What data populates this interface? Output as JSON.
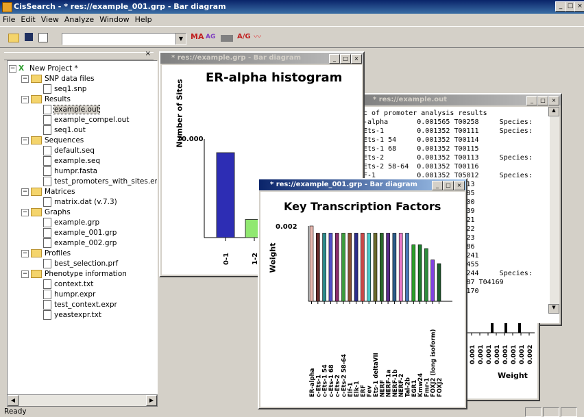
{
  "window": {
    "title": "CisSearch - * res://example_001.grp - Bar diagram"
  },
  "menu": [
    "File",
    "Edit",
    "View",
    "Analyze",
    "Window",
    "Help"
  ],
  "toolbar": {
    "search_value": "",
    "tool1": "MA",
    "tool2": "AG",
    "tool3": "A/G"
  },
  "tree": {
    "root": "New Project *",
    "groups": [
      {
        "label": "SNP data files",
        "items": [
          "seq1.snp"
        ]
      },
      {
        "label": "Results",
        "items": [
          "example.out",
          "example_compel.out",
          "seq1.out"
        ]
      },
      {
        "label": "Sequences",
        "items": [
          "default.seq",
          "example.seq",
          "humpr.fasta",
          "test_promoters_with_sites.emb"
        ]
      },
      {
        "label": "Matrices",
        "items": [
          "matrix.dat (v.7.3)"
        ]
      },
      {
        "label": "Graphs",
        "items": [
          "example.grp",
          "example_001.grp",
          "example_002.grp"
        ]
      },
      {
        "label": "Profiles",
        "items": [
          "best_selection.prf"
        ]
      },
      {
        "label": "Phenotype information",
        "items": [
          "context.txt",
          "humpr.expr",
          "test_context.expr",
          "yeastexpr.txt"
        ]
      }
    ]
  },
  "win_erhist": {
    "title": "* res://example.grp - Bar diagram",
    "chart_title": "ER-alpha histogram",
    "ylabel": "Number of Sites",
    "ytick": "70.000",
    "categories": [
      "0-1",
      "1-2"
    ]
  },
  "win_text": {
    "title": "* res://example.out",
    "lines": [
      "c of promoter analysis results",
      "-alpha       0.001565 T00258     Species:",
      "Ets-1        0.001352 T00111     Species:",
      "Ets-1 54     0.001352 T00114",
      "Ets-1 68     0.001352 T00115",
      "Ets-2        0.001352 T00113     Species:",
      "Ets-2 58-64  0.001352 T00116",
      "F-1          0.001352 T05012     Species:",
      "                      05013",
      "                      04885",
      "                      01400",
      "                      05039",
      "                      05021",
      "                      05022",
      "                      05023",
      "                      04886",
      "                      T00241",
      "                      T00455",
      "                      T00244     Species:",
      "                      06087 T04169",
      "                      T04170"
    ],
    "xticks": [
      "0.001",
      "0.001",
      "0.001",
      "0.001",
      "0.001",
      "0.001",
      "0.001",
      "0.002"
    ],
    "xlabel": "Weight"
  },
  "win_ktf": {
    "title": "* res://example_001.grp - Bar diagram",
    "chart_title": "Key Transcription Factors",
    "ylabel": "Weight",
    "ytick": "0.002"
  },
  "chart_data": [
    {
      "type": "bar",
      "title": "ER-alpha histogram",
      "ylabel": "Number of Sites",
      "categories": [
        "0-1",
        "1-2"
      ],
      "values": [
        70,
        15
      ],
      "colors": [
        "#2d2db4",
        "#90e870"
      ]
    },
    {
      "type": "bar",
      "title": "Key Transcription Factors",
      "ylabel": "Weight",
      "categories": [
        "ER-alpha",
        "c-Ets-1",
        "c-Ets-1 54",
        "c-Ets-1 68",
        "c-Ets-2",
        "c-Ets-2 58-64",
        "Elf-1",
        "Elk-1",
        "ERF",
        "Fev",
        "Ets-1 deltaVII",
        "NERF",
        "NERF-1a",
        "NERF-1b",
        "NERF-2",
        "Tal-2b",
        "EGR1",
        "Kmw24",
        "Fmr-1",
        "FOXJ2 (long isoform)",
        "FOXJ2"
      ],
      "values": [
        0.002,
        0.00181,
        0.00181,
        0.00181,
        0.00181,
        0.00181,
        0.00181,
        0.00181,
        0.00181,
        0.00181,
        0.00181,
        0.00181,
        0.00181,
        0.00181,
        0.00181,
        0.00181,
        0.0015,
        0.0015,
        0.0014,
        0.0011,
        0.001
      ],
      "colors": [
        "#e8b8b0",
        "#6a2c2c",
        "#2c8a8a",
        "#5050c8",
        "#8a2c6a",
        "#3c9c3c",
        "#8a5030",
        "#2c2c8a",
        "#c84848",
        "#48c8c8",
        "#6a6a2c",
        "#2c6a2c",
        "#5c2c8a",
        "#2c5c8a",
        "#e878c8",
        "#4878b8",
        "#2ca02c",
        "#1c7c2c",
        "#2c8c3c",
        "#8040e0",
        "#1c5c2c"
      ],
      "ytick": "0.002"
    }
  ],
  "status": {
    "text": "Ready"
  }
}
